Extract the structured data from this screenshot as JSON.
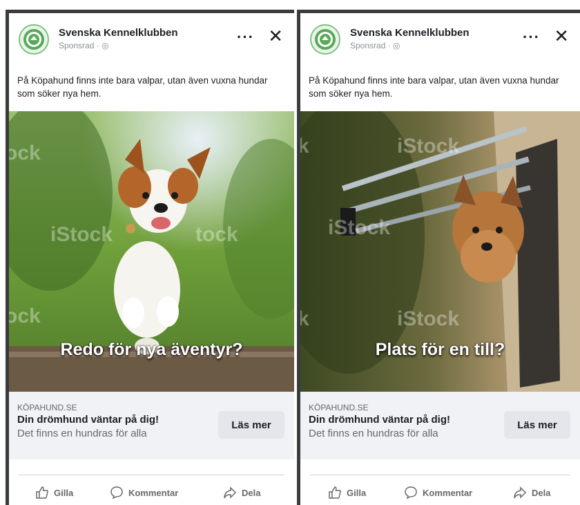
{
  "ads": [
    {
      "page_name": "Svenska Kennelklubben",
      "sponsored": "Sponsrad · ",
      "more_icon": "···",
      "close_icon": "✕",
      "text": "På Köpahund finns inte bara valpar, utan även vuxna hundar som söker nya hem.",
      "image_caption": "Redo för nya äventyr?",
      "watermark": "iStock",
      "link_domain": "KÖPAHUND.SE",
      "link_headline": "Din drömhund väntar på dig!",
      "link_description": "Det finns en hundras för alla",
      "cta_label": "Läs mer",
      "actions": {
        "like": "Gilla",
        "comment": "Kommentar",
        "share": "Dela"
      }
    },
    {
      "page_name": "Svenska Kennelklubben",
      "sponsored": "Sponsrad · ",
      "more_icon": "···",
      "close_icon": "✕",
      "text": "På Köpahund finns inte bara valpar, utan även vuxna hundar som söker nya hem.",
      "image_caption": "Plats för en till?",
      "watermark": "iStock",
      "link_domain": "KÖPAHUND.SE",
      "link_headline": "Din drömhund väntar på dig!",
      "link_description": "Det finns en hundras för alla",
      "cta_label": "Läs mer",
      "actions": {
        "like": "Gilla",
        "comment": "Kommentar",
        "share": "Dela"
      }
    }
  ],
  "colors": {
    "text_primary": "#1c1e21",
    "text_secondary": "#65676b",
    "link_box_bg": "#f0f2f5",
    "button_bg": "#e4e6eb",
    "frame": "#3a3b3d"
  },
  "icons": [
    "kennel-logo-icon",
    "globe-icon",
    "more-icon",
    "close-icon",
    "like-icon",
    "comment-icon",
    "share-icon"
  ]
}
